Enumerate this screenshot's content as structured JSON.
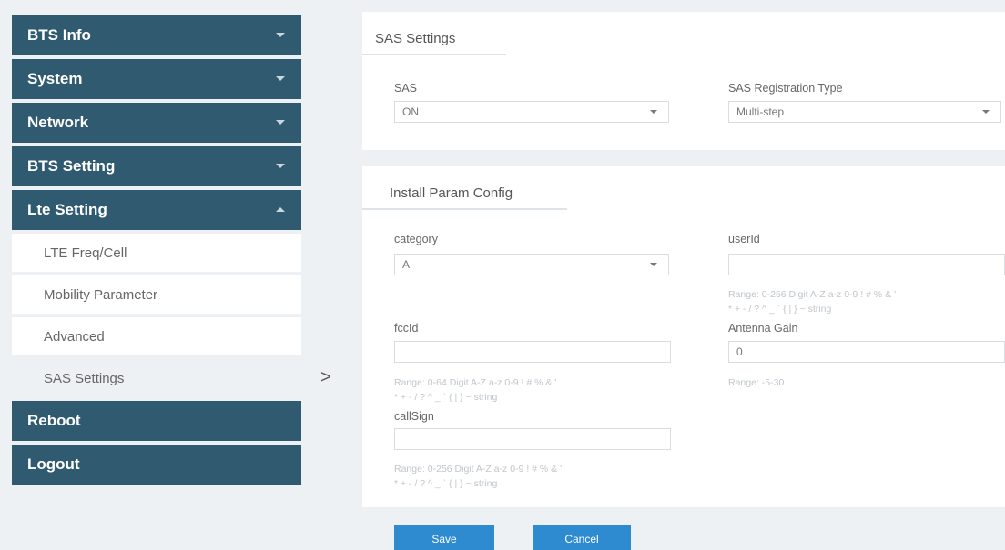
{
  "sidebar": {
    "nav": {
      "bts_info": "BTS Info",
      "system": "System",
      "network": "Network",
      "bts_setting": "BTS Setting",
      "lte_setting": "Lte Setting",
      "reboot": "Reboot",
      "logout": "Logout"
    },
    "lte_sub": [
      "LTE Freq/Cell",
      "Mobility Parameter",
      "Advanced",
      "SAS Settings"
    ],
    "active": "SAS Settings"
  },
  "expand_arrow": ">",
  "sas_panel": {
    "title": "SAS Settings",
    "sas_label": "SAS",
    "sas_value": "ON",
    "reg_type_label": "SAS Registration Type",
    "reg_type_value": "Multi-step"
  },
  "install_panel": {
    "title": "Install Param Config",
    "category_label": "category",
    "category_value": "A",
    "userid_label": "userId",
    "userid_value": "",
    "userid_hint_1": "Range: 0-256 Digit A-Z a-z 0-9 ! # % & '",
    "userid_hint_2": "* + - / ? ^ _ ` { | } ~ string",
    "fccid_label": "fccId",
    "fccid_value": "",
    "fccid_hint_1": "Range: 0-64 Digit A-Z a-z 0-9 ! # % & '",
    "fccid_hint_2": "* + - / ? ^ _ ` { | } ~ string",
    "antenna_label": "Antenna Gain",
    "antenna_value": "0",
    "antenna_hint": "Range: -5-30",
    "callsign_label": "callSign",
    "callsign_value": "",
    "callsign_hint_1": "Range: 0-256 Digit A-Z a-z 0-9 ! # % & '",
    "callsign_hint_2": "* + - / ? ^ _ ` { | } ~ string"
  },
  "buttons": {
    "save": "Save",
    "cancel": "Cancel"
  }
}
